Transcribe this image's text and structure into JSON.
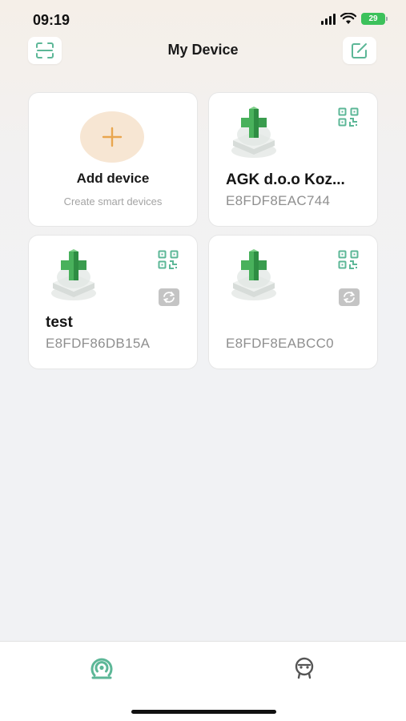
{
  "status_bar": {
    "time": "09:19",
    "battery": "29"
  },
  "header": {
    "title": "My Device",
    "left_icon": "scan-icon",
    "right_icon": "edit-icon"
  },
  "add_card": {
    "title": "Add device",
    "subtitle": "Create smart devices",
    "icon": "plus-icon"
  },
  "devices": [
    {
      "name": "AGK d.o.o Koz...",
      "id": "E8FDF8EAC744"
    },
    {
      "name": "test",
      "id": "E8FDF86DB15A"
    },
    {
      "name": "",
      "id": "E8FDF8EABCC0"
    }
  ],
  "tab_bar": {
    "tabs": [
      {
        "icon": "home-target-icon",
        "active": true
      },
      {
        "icon": "robot-profile-icon",
        "active": false
      }
    ]
  },
  "colors": {
    "accent_green": "#5cb797",
    "add_orange": "#e9a64f",
    "add_circle_bg": "#f7e6d3",
    "battery_green": "#3cc15b"
  }
}
